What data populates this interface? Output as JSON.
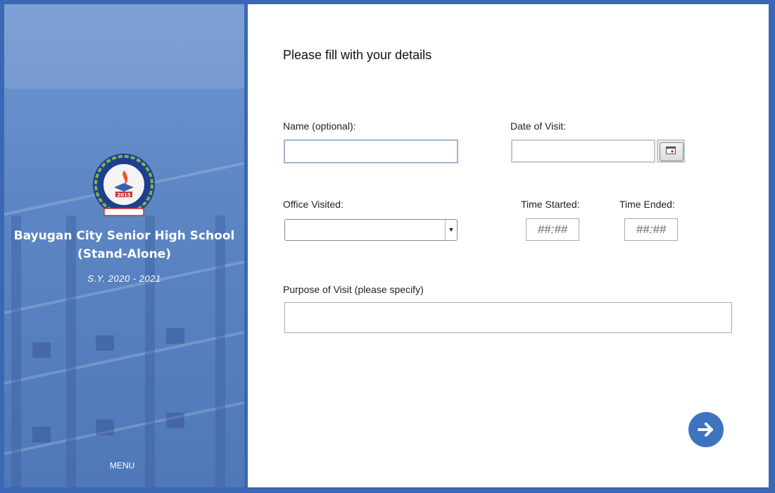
{
  "sidebar": {
    "school_name_line1": "Bayugan City Senior High School",
    "school_name_line2": "(Stand-Alone)",
    "school_year": "S.Y. 2020 - 2021",
    "menu_label": "MENU",
    "logo": {
      "year": "2015",
      "icon": "school-seal-logo"
    }
  },
  "form": {
    "heading": "Please fill with your details",
    "name_label": "Name (optional):",
    "name_value": "",
    "date_label": "Date of Visit:",
    "date_value": "",
    "office_label": "Office Visited:",
    "office_selected": "",
    "time_started_label": "Time Started:",
    "time_started_placeholder": "##:##",
    "time_ended_label": "Time Ended:",
    "time_ended_placeholder": "##:##",
    "purpose_label": "Purpose of Visit (please specify)",
    "purpose_value": ""
  },
  "icons": {
    "calendar": "calendar-icon",
    "next": "arrow-right-icon"
  },
  "colors": {
    "accent": "#3f73bf",
    "frame": "#3a68b5"
  }
}
